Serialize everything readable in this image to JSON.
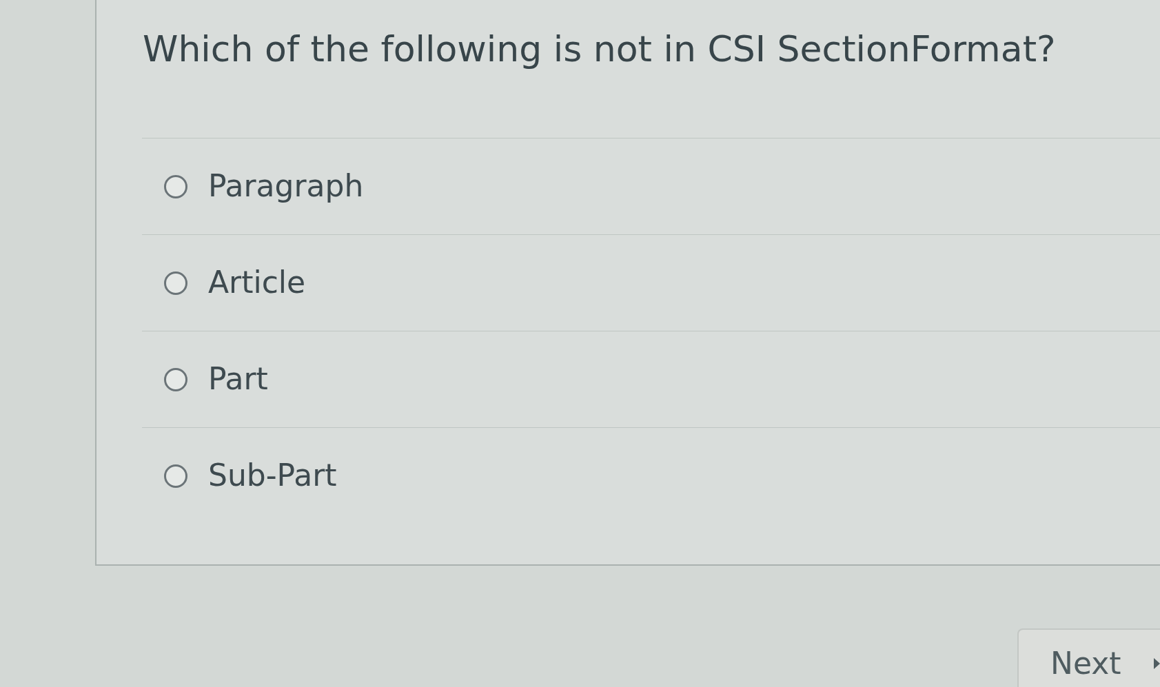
{
  "question": {
    "text": "Which of the following is not in CSI SectionFormat?"
  },
  "options": [
    {
      "label": "Paragraph",
      "selected": false
    },
    {
      "label": "Article",
      "selected": false
    },
    {
      "label": "Part",
      "selected": false
    },
    {
      "label": "Sub-Part",
      "selected": false
    }
  ],
  "next_button": {
    "label": "Next"
  }
}
